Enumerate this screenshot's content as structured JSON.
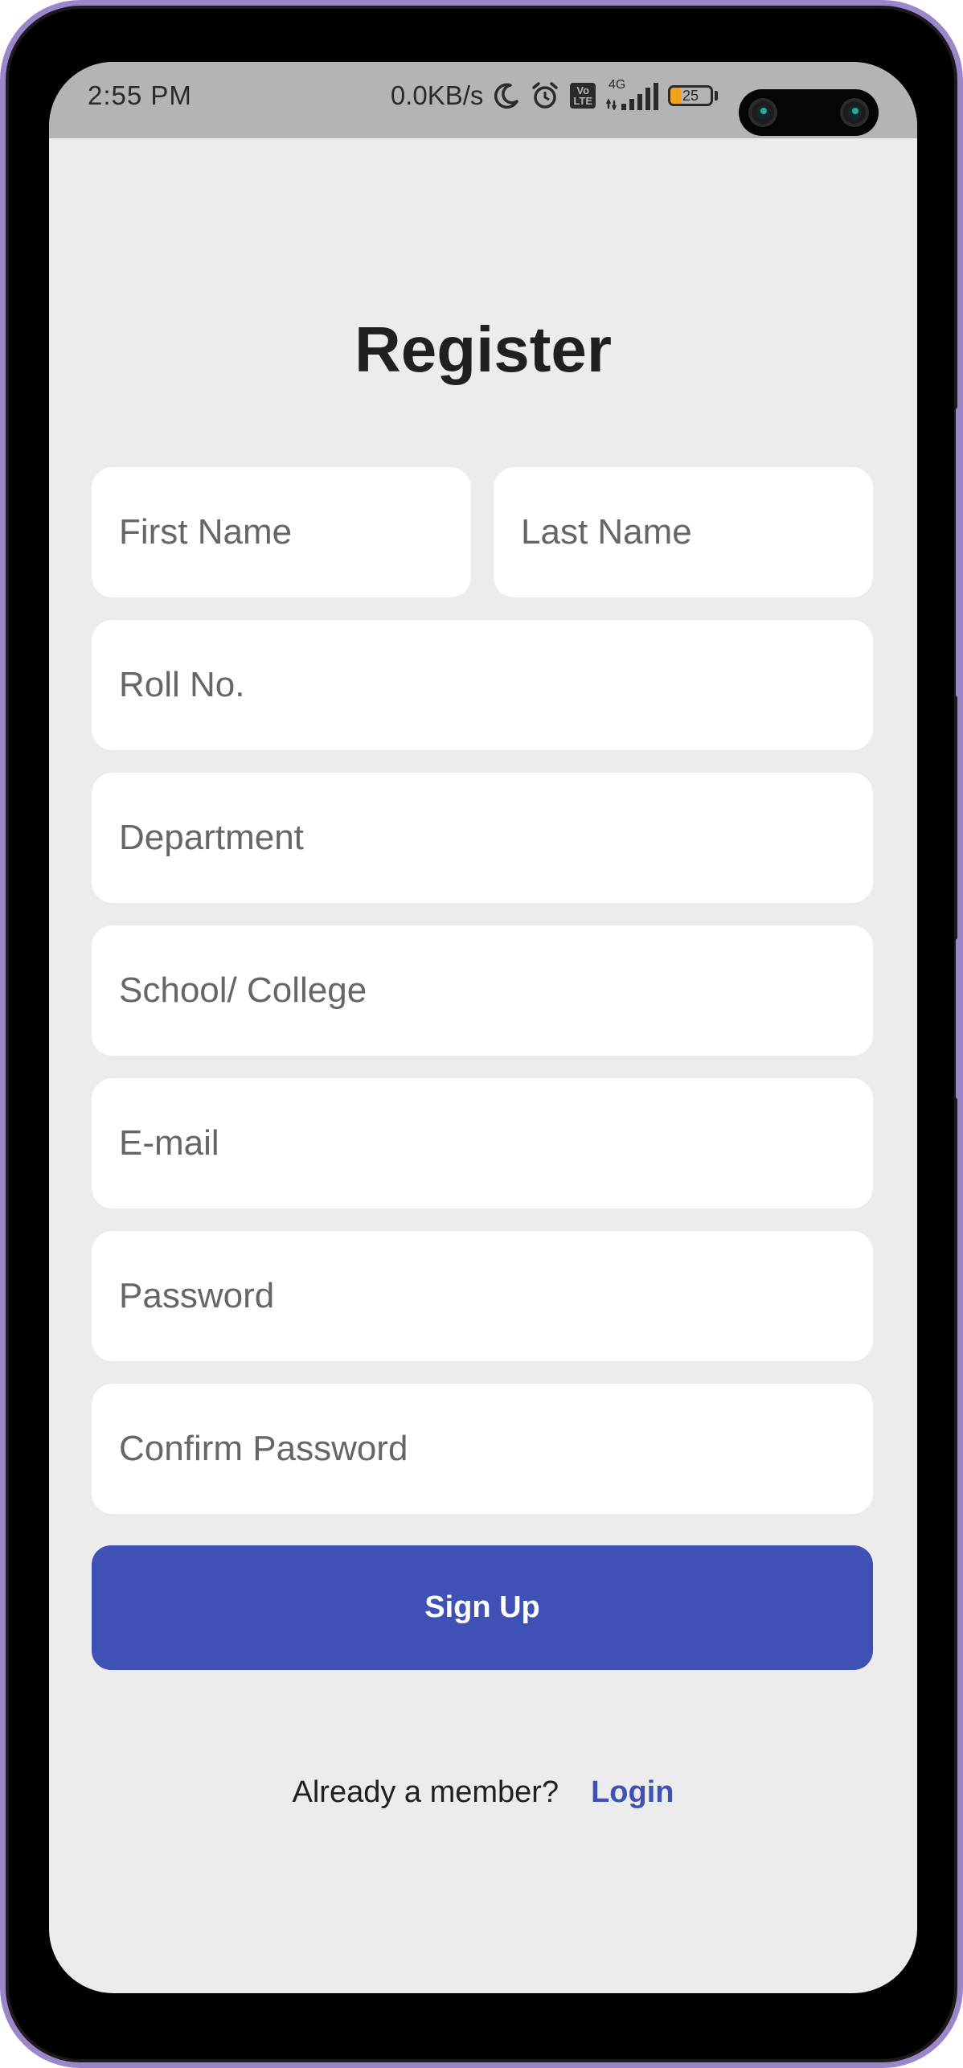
{
  "status_bar": {
    "time": "2:55 PM",
    "net_speed": "0.0KB/s",
    "network_type": "4G",
    "volte_top": "Vo",
    "volte_bottom": "LTE",
    "battery_level": "25",
    "battery_fraction": 0.25,
    "battery_color": "#f0a31b",
    "icons": [
      "moon-icon",
      "alarm-icon",
      "volte-icon",
      "signal-icon",
      "battery-icon"
    ]
  },
  "form": {
    "title": "Register",
    "fields": {
      "first_name": "First Name",
      "last_name": "Last Name",
      "roll_no": "Roll No.",
      "department": "Department",
      "school": "School/ College",
      "email": "E-mail",
      "password": "Password",
      "confirm_password": "Confirm Password"
    },
    "submit_label": "Sign Up",
    "already_member": "Already a member?",
    "login_label": "Login"
  },
  "colors": {
    "accent": "#3f51b5",
    "background": "#ececec",
    "field_background": "#ffffff",
    "status_bar": "#b4b4b4",
    "frame": "#9a86c8"
  }
}
